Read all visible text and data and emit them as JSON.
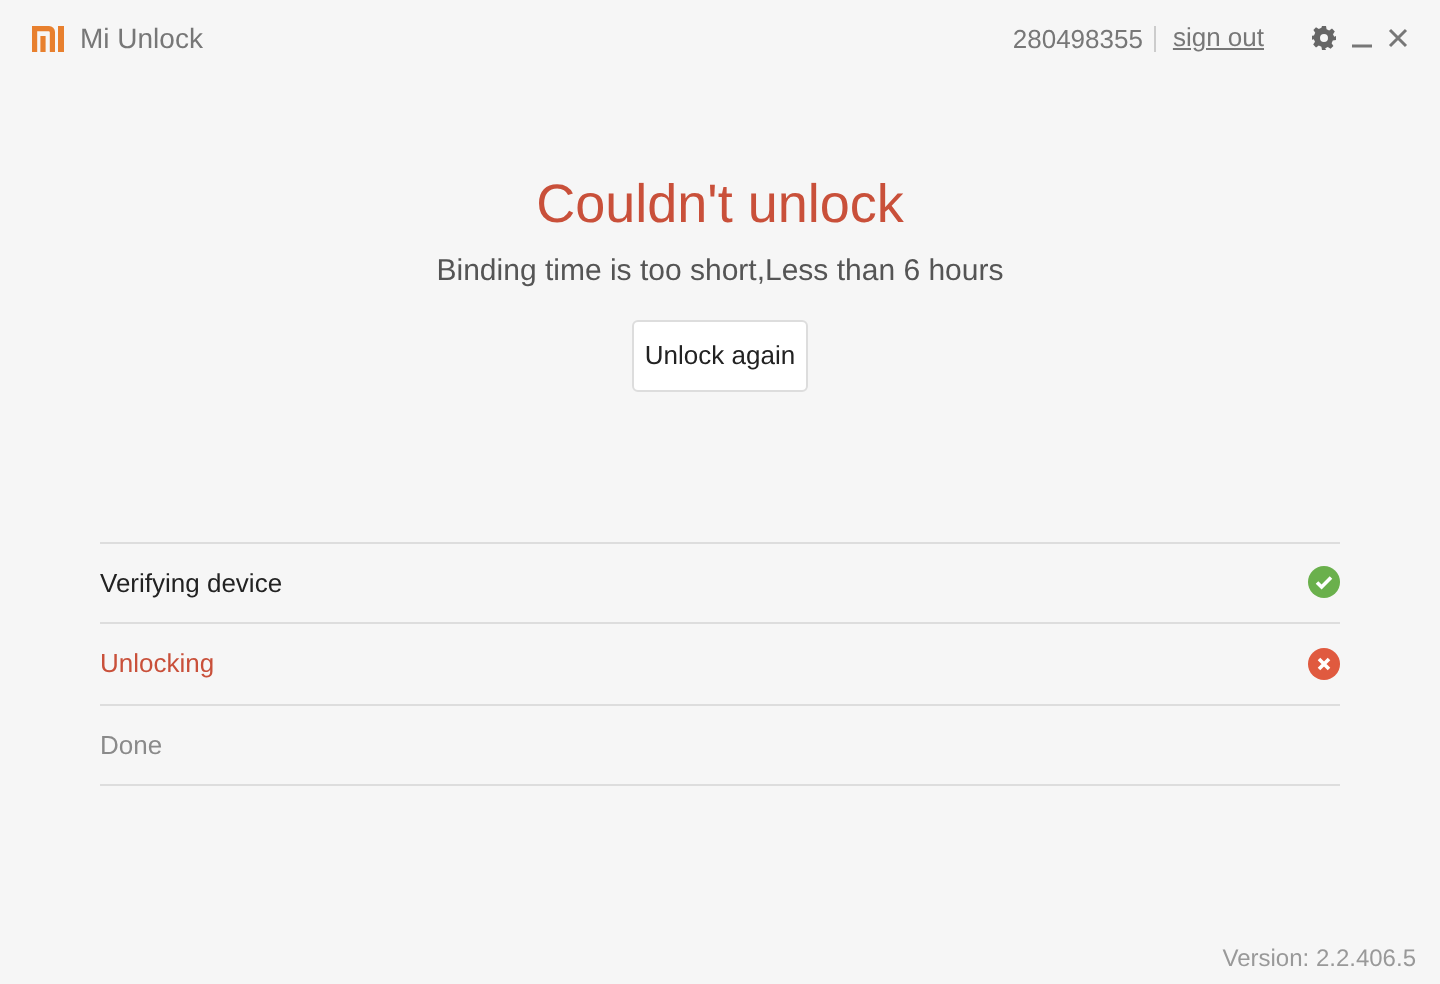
{
  "window": {
    "title": "Mi Unlock"
  },
  "account": {
    "id": "280498355",
    "sign_out": "sign out"
  },
  "result": {
    "title": "Couldn't unlock",
    "message": "Binding time is too short,Less than 6 hours",
    "button": "Unlock again"
  },
  "steps": [
    {
      "label": "Verifying device",
      "kind": "success"
    },
    {
      "label": "Unlocking",
      "kind": "failed"
    },
    {
      "label": "Done",
      "kind": "pending"
    }
  ],
  "version": "Version: 2.2.406.5"
}
